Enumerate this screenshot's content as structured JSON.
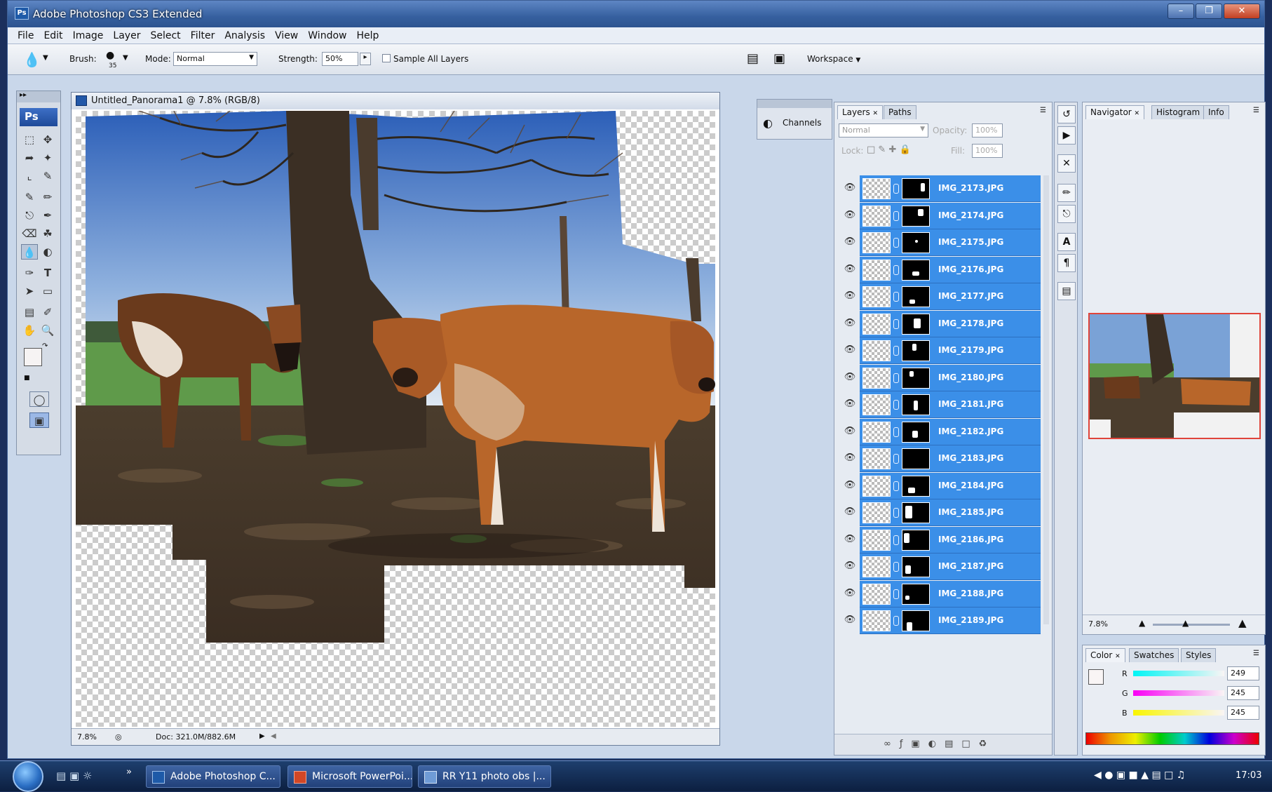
{
  "window": {
    "title": "Adobe Photoshop CS3 Extended",
    "app_tag": "Ps"
  },
  "menu": [
    "File",
    "Edit",
    "Image",
    "Layer",
    "Select",
    "Filter",
    "Analysis",
    "View",
    "Window",
    "Help"
  ],
  "options": {
    "brush_label": "Brush:",
    "brush_size": "35",
    "mode_label": "Mode:",
    "mode_value": "Normal",
    "strength_label": "Strength:",
    "strength_value": "50%",
    "sample_all_layers": "Sample All Layers",
    "workspace": "Workspace"
  },
  "toolbox": {
    "logo": "Ps"
  },
  "document": {
    "tab_title": "Untitled_Panorama1 @ 7.8% (RGB/8)",
    "zoom": "7.8%",
    "doc_info": "Doc: 321.0M/882.6M"
  },
  "channels_panel": {
    "label": "Channels"
  },
  "layers_panel": {
    "tabs": [
      "Layers",
      "Paths"
    ],
    "blend_mode": "Normal",
    "opacity_label": "Opacity:",
    "opacity_value": "100%",
    "lock_label": "Lock:",
    "fill_label": "Fill:",
    "fill_value": "100%",
    "layers": [
      "IMG_2173.JPG",
      "IMG_2174.JPG",
      "IMG_2175.JPG",
      "IMG_2176.JPG",
      "IMG_2177.JPG",
      "IMG_2178.JPG",
      "IMG_2179.JPG",
      "IMG_2180.JPG",
      "IMG_2181.JPG",
      "IMG_2182.JPG",
      "IMG_2183.JPG",
      "IMG_2184.JPG",
      "IMG_2185.JPG",
      "IMG_2186.JPG",
      "IMG_2187.JPG",
      "IMG_2188.JPG",
      "IMG_2189.JPG"
    ]
  },
  "navigator_panel": {
    "tabs": [
      "Navigator",
      "Histogram",
      "Info"
    ],
    "zoom": "7.8%"
  },
  "color_panel": {
    "tabs": [
      "Color",
      "Swatches",
      "Styles"
    ],
    "channels": [
      {
        "label": "R",
        "value": "249"
      },
      {
        "label": "G",
        "value": "245"
      },
      {
        "label": "B",
        "value": "245"
      }
    ]
  },
  "taskbar": {
    "tasks": [
      "Adobe Photoshop C...",
      "Microsoft PowerPoi...",
      "RR Y11 photo obs |..."
    ],
    "clock": "17:03"
  },
  "colors": {
    "selection_blue": "#3b8fe8",
    "title_blue": "#36609f"
  }
}
